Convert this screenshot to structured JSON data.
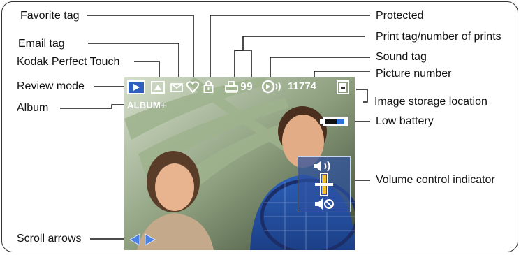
{
  "callouts": {
    "favorite_tag": "Favorite tag",
    "email_tag": "Email tag",
    "kodak_perfect_touch": "Kodak Perfect Touch",
    "review_mode": "Review mode",
    "album": "Album",
    "scroll_arrows": "Scroll arrows",
    "protected": "Protected",
    "print_tag": "Print tag/number of prints",
    "sound_tag": "Sound tag",
    "picture_number": "Picture number",
    "image_storage_location": "Image storage location",
    "low_battery": "Low battery",
    "volume_control_indicator": "Volume control indicator"
  },
  "screen": {
    "print_count": "99",
    "picture_number": "11774",
    "album_text": "ALBUM+"
  },
  "icons": {
    "review_mode": "review-mode-icon",
    "perfect_touch": "perfect-touch-icon",
    "email": "envelope-icon",
    "favorite": "heart-icon",
    "protected": "lock-icon",
    "print": "printer-icon",
    "sound": "sound-icon",
    "storage": "storage-card-icon",
    "battery": "battery-icon",
    "volume_up": "speaker-up-icon",
    "volume_mute": "speaker-mute-icon",
    "scroll_left": "left-arrow-icon",
    "scroll_right": "right-arrow-icon"
  },
  "colors": {
    "osd_blue": "#3a64c8",
    "battery_fill": "#2f6fd6",
    "volume_panel": "#2d4f9e"
  }
}
